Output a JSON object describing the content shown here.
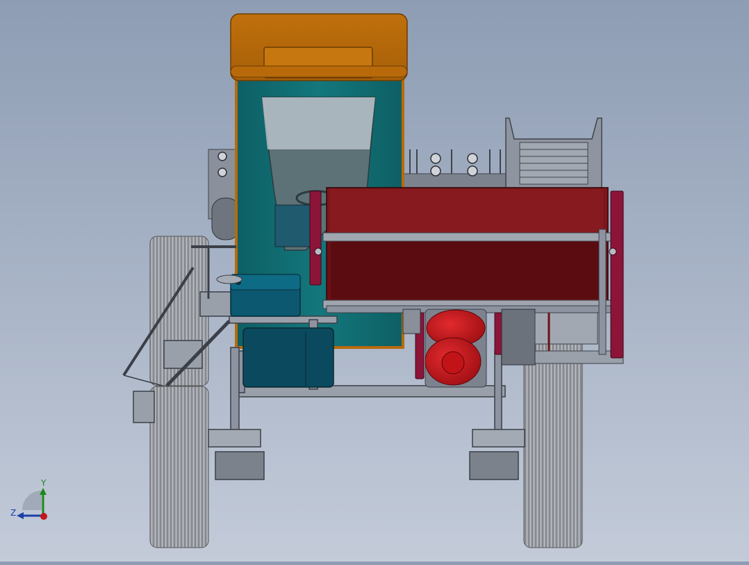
{
  "viewport": {
    "background_top": "#8e9db4",
    "background_bottom": "#c3cbd9",
    "model": {
      "cab_roof": "#b86a0a",
      "cab_body": "#0f6e73",
      "hopper": "#8a1a1e",
      "tank_red": "#c8151b",
      "battery_box": "#0b5870",
      "frame_steel": "#8d93a0",
      "posts_magenta": "#8d1439",
      "tire_gray": "#9a9da3"
    }
  },
  "triad": {
    "y_label": "Y",
    "z_label": "Z",
    "icons": [
      "y-axis-icon",
      "z-axis-icon",
      "x-axis-icon"
    ]
  }
}
